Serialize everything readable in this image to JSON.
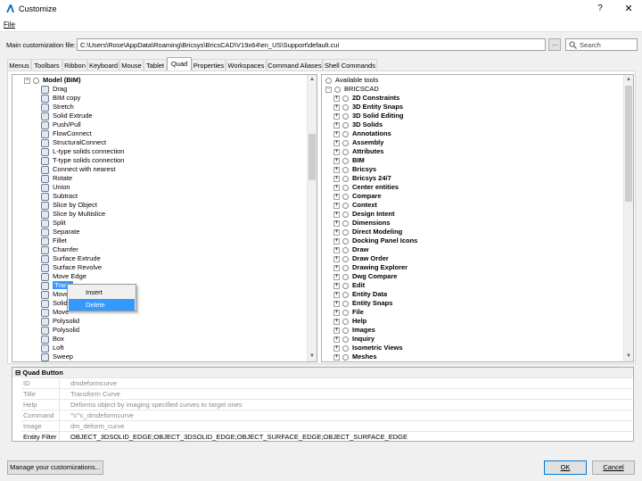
{
  "window": {
    "title": "Customize",
    "help": "?",
    "close": "✕"
  },
  "menubar": {
    "file": "File"
  },
  "main_file": {
    "label": "Main customization file:",
    "path": "C:\\Users\\Rose\\AppData\\Roaming\\Bricsys\\BricsCAD\\V19x64\\en_US\\Support\\default.cui",
    "browse": "...",
    "search_placeholder": "Search"
  },
  "tabs": [
    {
      "label": "Menus"
    },
    {
      "label": "Toolbars"
    },
    {
      "label": "Ribbon"
    },
    {
      "label": "Keyboard"
    },
    {
      "label": "Mouse"
    },
    {
      "label": "Tablet"
    },
    {
      "label": "Quad"
    },
    {
      "label": "Properties"
    },
    {
      "label": "Workspaces"
    },
    {
      "label": "Command Aliases"
    },
    {
      "label": "Shell Commands"
    }
  ],
  "active_tab": "Quad",
  "left_tree": {
    "root": "Model (BIM)",
    "items": [
      "Drag",
      "BIM copy",
      "Stretch",
      "Solid Extrude",
      "Push/Pull",
      "FlowConnect",
      "StructuralConnect",
      "L-type solids connection",
      "T-type solids connection",
      "Connect with nearest",
      "Rotate",
      "Union",
      "Subtract",
      "Slice by Object",
      "Slice by Multislice",
      "Split",
      "Separate",
      "Fillet",
      "Chamfer",
      "Surface Extrude",
      "Surface Revolve",
      "Move Edge",
      "Transform Curve",
      "Move",
      "Solid",
      "Move",
      "Polysolid",
      "Polysolid",
      "Box",
      "Loft",
      "Sweep"
    ],
    "selected_visible_text": "Trans"
  },
  "context_menu": {
    "items": [
      "Insert",
      "Delete"
    ],
    "highlighted": "Delete"
  },
  "right_tree": {
    "header": "Available tools",
    "root": "BRICSCAD",
    "groups": [
      "2D Constraints",
      "3D Entity Snaps",
      "3D Solid Editing",
      "3D Solids",
      "Annotations",
      "Assembly",
      "Attributes",
      "BIM",
      "Bricsys",
      "Bricsys 24/7",
      "Center entities",
      "Compare",
      "Context",
      "Design Intent",
      "Dimensions",
      "Direct Modeling",
      "Docking Panel Icons",
      "Draw",
      "Draw Order",
      "Drawing Explorer",
      "Dwg Compare",
      "Edit",
      "Entity Data",
      "Entity Snaps",
      "File",
      "Help",
      "Images",
      "Inquiry",
      "Isometric Views",
      "Meshes"
    ]
  },
  "properties": {
    "header": "Quad Button",
    "rows": [
      {
        "name": "ID",
        "value": "dmdeformcurve"
      },
      {
        "name": "Title",
        "value": "Transform Curve"
      },
      {
        "name": "Help",
        "value": "Deforms object by imaging specified curves to target ones"
      },
      {
        "name": "Command",
        "value": "^c^c_dmdeformcurve"
      },
      {
        "name": "Image",
        "value": "dm_deform_curve"
      },
      {
        "name": "Entity Filter",
        "value": "OBJECT_3DSOLID_EDGE;OBJECT_3DSOLID_EDGE;OBJECT_SURFACE_EDGE;OBJECT_SURFACE_EDGE"
      }
    ]
  },
  "buttons": {
    "manage": "Manage your customizations...",
    "ok": "OK",
    "cancel": "Cancel"
  },
  "colors": {
    "selection": "#3399ff",
    "accent": "#0078d7",
    "window_bg": "#f0f0f0"
  }
}
